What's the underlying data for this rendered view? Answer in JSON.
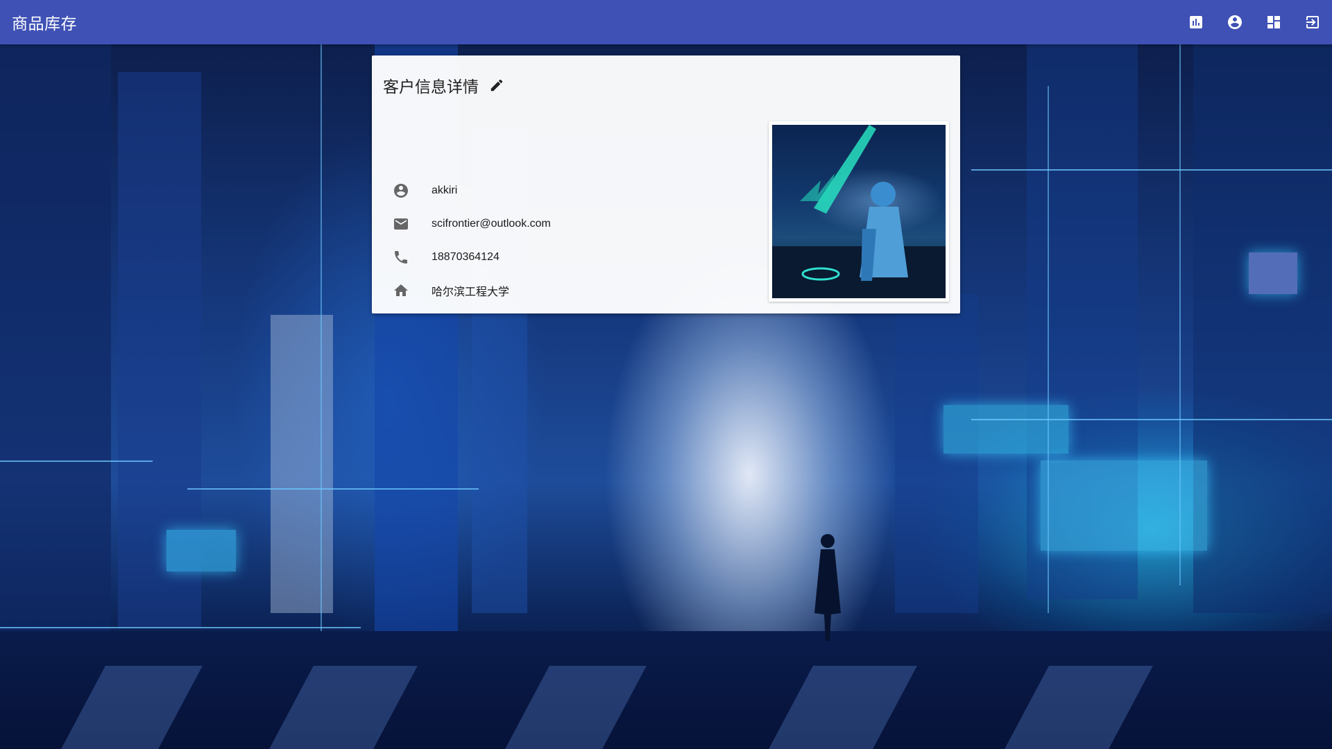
{
  "app": {
    "title": "商品库存"
  },
  "toolbar": {
    "icons": [
      "bar-chart-icon",
      "account-circle-icon",
      "dashboard-icon",
      "logout-icon"
    ]
  },
  "card": {
    "title": "客户信息详情",
    "edit_icon": "pencil-icon",
    "fields": [
      {
        "icon": "account-circle-icon",
        "value": "akkiri"
      },
      {
        "icon": "mail-icon",
        "value": "scifrontier@outlook.com"
      },
      {
        "icon": "phone-icon",
        "value": "18870364124"
      },
      {
        "icon": "home-icon",
        "value": "哈尔滨工程大学"
      }
    ]
  },
  "colors": {
    "appbar": "#3f51b5",
    "card_background": "#ffffff",
    "icon_grey": "#666666"
  }
}
